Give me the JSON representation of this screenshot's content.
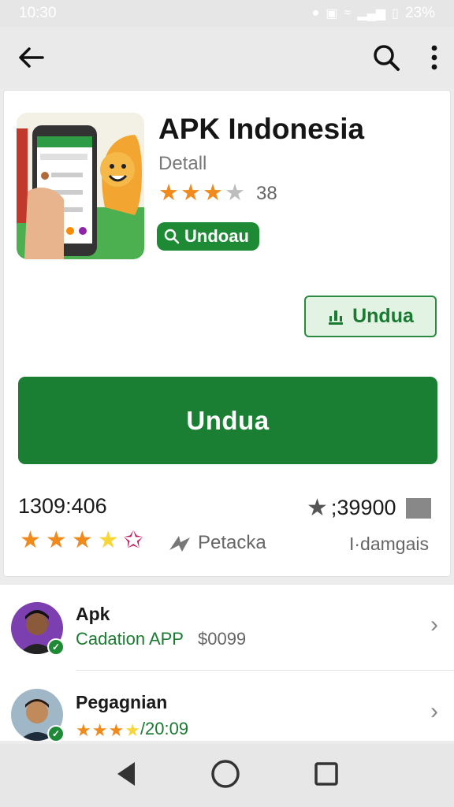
{
  "status": {
    "time": "10:30",
    "right_text": "23%",
    "icons": [
      "notification-icon",
      "image-icon",
      "wifi-icon",
      "signal-icon",
      "battery-icon"
    ]
  },
  "app_bar": {
    "icons": [
      "back-arrow-icon",
      "search-icon",
      "more-vert-icon"
    ]
  },
  "app": {
    "title": "APK Indonesia",
    "subtitle": "Detall",
    "rating": 3,
    "rating_count": "38",
    "chip_label": "Undoau",
    "secondary_button": "Undua",
    "primary_button": "Undua"
  },
  "stats": {
    "left": "1309:406",
    "right": ";39900",
    "rating": 4,
    "middle_label": "Petacka",
    "right_label": "I·damgais"
  },
  "list": [
    {
      "title": "Apk",
      "subtitle": "Cadation APP",
      "price": "$0099"
    },
    {
      "title": "Pegagnian",
      "rating": 4,
      "subtitle": "/20:09"
    }
  ],
  "colors": {
    "green": "#1b7f33",
    "star_orange": "#f08a1c",
    "star_yellow": "#f7d63a",
    "star_gray": "#bdbdbd"
  }
}
